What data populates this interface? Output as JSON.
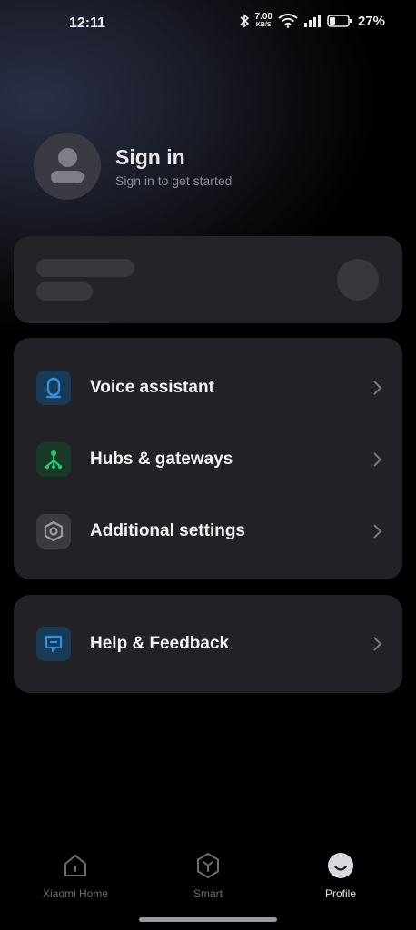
{
  "status_bar": {
    "time": "12:11",
    "net_speed_value": "7.00",
    "net_speed_unit": "KB/S",
    "battery": "27%"
  },
  "profile": {
    "title": "Sign in",
    "subtitle": "Sign in to get started"
  },
  "menu": {
    "items": [
      {
        "label": "Voice assistant",
        "icon": "microphone-icon",
        "color": "#2f8fe0"
      },
      {
        "label": "Hubs & gateways",
        "icon": "hub-icon",
        "color": "#2cc36b"
      },
      {
        "label": "Additional settings",
        "icon": "settings-icon",
        "color": "#9a9aa2"
      }
    ]
  },
  "help": {
    "label": "Help & Feedback",
    "icon": "feedback-icon",
    "color": "#2f8fe0"
  },
  "bottom_nav": {
    "items": [
      {
        "label": "Xiaomi Home",
        "icon": "home-icon",
        "active": false
      },
      {
        "label": "Smart",
        "icon": "smart-icon",
        "active": false
      },
      {
        "label": "Profile",
        "icon": "profile-icon",
        "active": true
      }
    ]
  }
}
